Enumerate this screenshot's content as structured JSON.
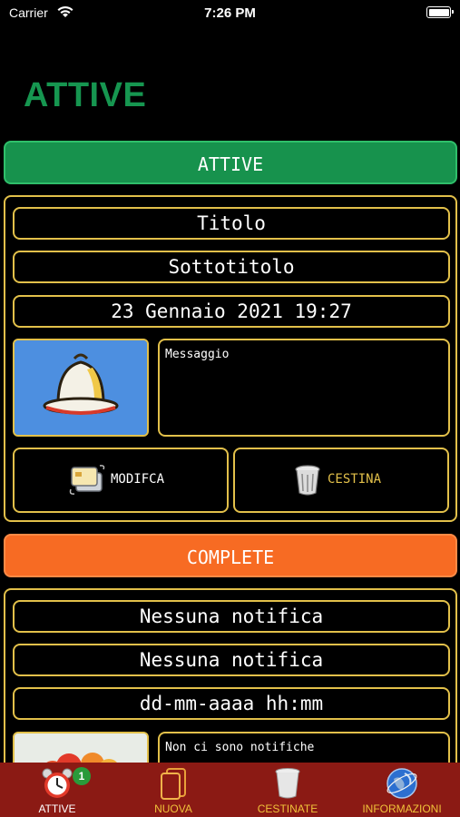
{
  "status": {
    "carrier": "Carrier",
    "time": "7:26 PM"
  },
  "header": {
    "title": "ATTIVE"
  },
  "sections": {
    "active": "ATTIVE",
    "complete": "COMPLETE"
  },
  "active_card": {
    "title": "Titolo",
    "subtitle": "Sottotitolo",
    "datetime": "23 Gennaio 2021 19:27",
    "message": "Messaggio",
    "edit_label": "MODIFCA",
    "trash_label": "CESTINA"
  },
  "complete_card": {
    "title": "Nessuna notifica",
    "subtitle": "Nessuna notifica",
    "datetime": "dd-mm-aaaa hh:mm",
    "message": "Non ci sono notifiche"
  },
  "tabs": [
    {
      "label": "ATTIVE",
      "icon": "alarm-clock-icon",
      "badge": "1"
    },
    {
      "label": "NUOVA",
      "icon": "new-device-icon"
    },
    {
      "label": "CESTINATE",
      "icon": "trash-icon"
    },
    {
      "label": "INFORMAZIONI",
      "icon": "globe-icon"
    }
  ],
  "colors": {
    "green": "#17924d",
    "orange": "#f76b23",
    "gold": "#e2c04a",
    "tabbar": "#8b1a14"
  }
}
